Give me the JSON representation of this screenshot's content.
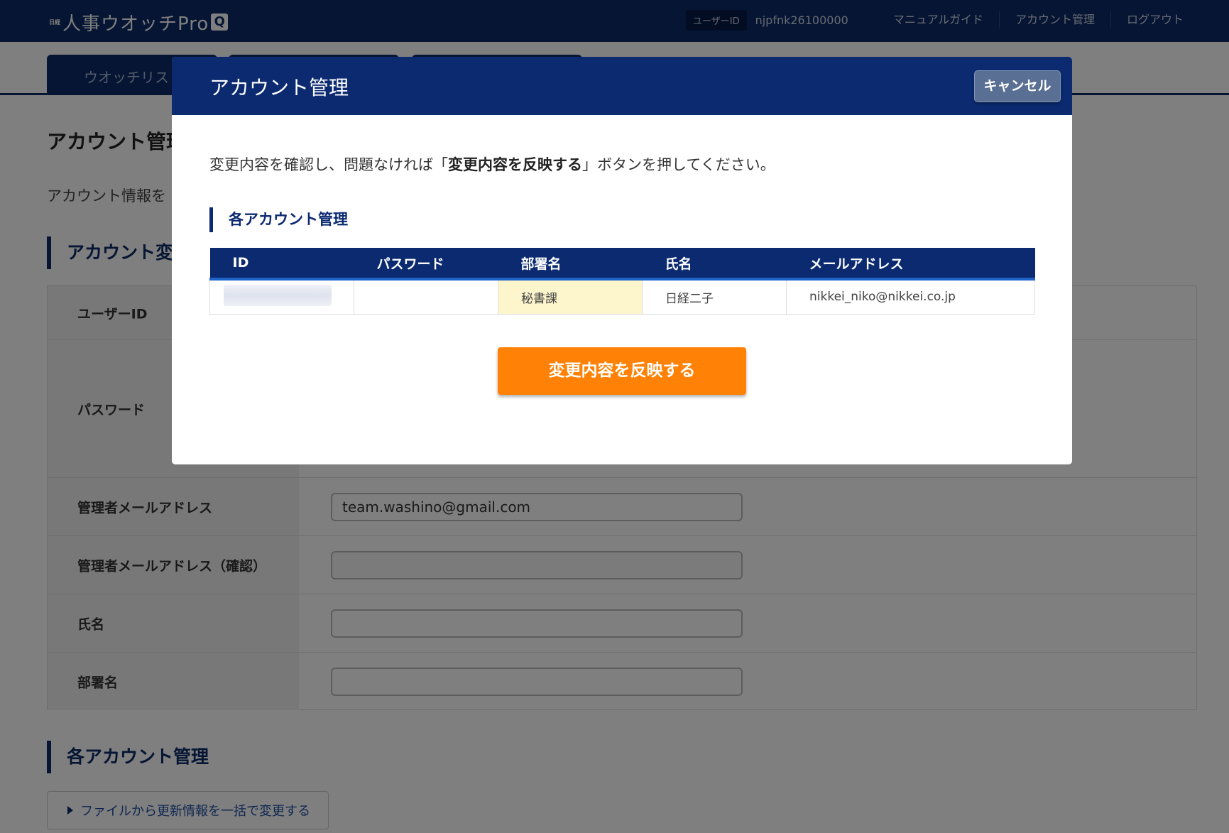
{
  "header": {
    "logo_mark": "日経",
    "logo_text": "人事ウオッチPro",
    "logo_q": "Q",
    "userid_label": "ユーザーID",
    "userid_value": "njpfnk26100000",
    "nav": [
      "マニュアルガイド",
      "アカウント管理",
      "ログアウト"
    ]
  },
  "tabs": [
    "ウオッチリスト",
    "",
    ""
  ],
  "page": {
    "title": "アカウント管理",
    "description": "アカウント情報を",
    "section_account_change": "アカウント変",
    "form": {
      "rows": [
        {
          "label": "ユーザーID",
          "value": ""
        },
        {
          "label": "パスワード",
          "value": ""
        },
        {
          "label": "管理者メールアドレス",
          "value": "team.washino@gmail.com"
        },
        {
          "label": "管理者メールアドレス（確認）",
          "value": ""
        },
        {
          "label": "氏名",
          "value": ""
        },
        {
          "label": "部署名",
          "value": ""
        }
      ]
    },
    "section_each_account": "各アカウント管理",
    "bulk_link": "ファイルから更新情報を一括で変更する"
  },
  "modal": {
    "title": "アカウント管理",
    "cancel": "キャンセル",
    "message_before": "変更内容を確認し、問題なければ「",
    "message_bold": "変更内容を反映する",
    "message_after": "」ボタンを押してください。",
    "section": "各アカウント管理",
    "table": {
      "headers": [
        "ID",
        "パスワード",
        "部署名",
        "氏名",
        "メールアドレス"
      ],
      "rows": [
        {
          "id": "",
          "password": "",
          "department": "秘書課",
          "name": "日経二子",
          "email": "nikkei_niko@nikkei.co.jp"
        }
      ]
    },
    "apply_button": "変更内容を反映する"
  },
  "colors": {
    "navy": "#0b2a66",
    "modal_header": "#0b2a70",
    "accent_blue": "#1f63c9",
    "apply_orange": "#ff8206",
    "highlight_yellow": "#fdf6cc",
    "cancel_gray_blue": "#5a6f94"
  }
}
